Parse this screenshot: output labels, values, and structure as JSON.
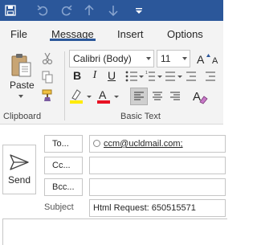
{
  "tabs": {
    "file": "File",
    "message": "Message",
    "insert": "Insert",
    "options": "Options"
  },
  "clipboard": {
    "paste_label": "Paste",
    "group_label": "Clipboard"
  },
  "basic_text": {
    "font_family": "Calibri (Body)",
    "font_size": "11",
    "bold": "B",
    "italic": "I",
    "underline": "U",
    "group_label": "Basic Text"
  },
  "compose": {
    "send_label": "Send",
    "to_label": "To...",
    "cc_label": "Cc...",
    "bcc_label": "Bcc...",
    "subject_label": "Subject",
    "to_value": "ccm@ucldmail.com;",
    "cc_value": "",
    "bcc_value": "",
    "subject_value": "Html Request: 650515571"
  },
  "colors": {
    "title_bar": "#2b579a",
    "ribbon_bg": "#f3f3f3",
    "highlight_color": "#ffeb00",
    "font_color": "#e81123"
  }
}
